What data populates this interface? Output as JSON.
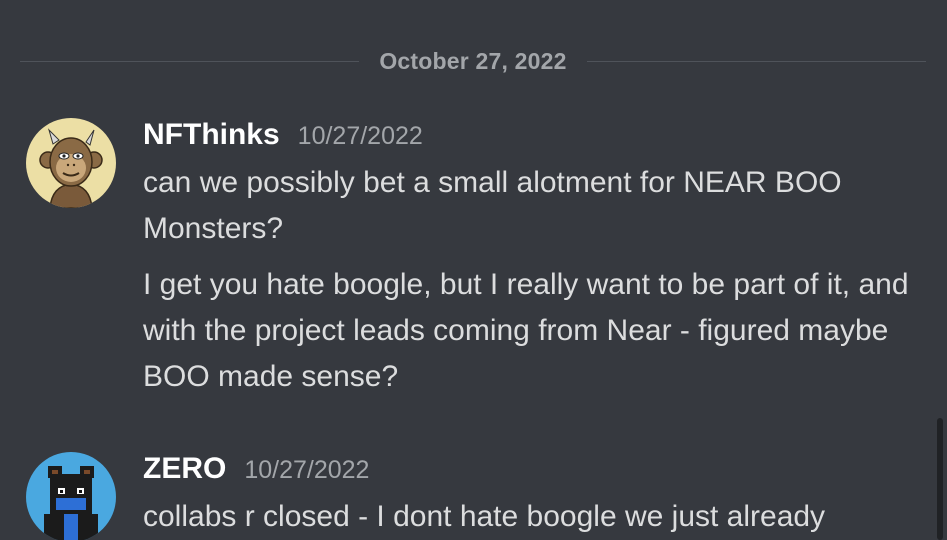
{
  "divider": {
    "date": "October 27, 2022"
  },
  "messages": [
    {
      "username": "NFThinks",
      "timestamp": "10/27/2022",
      "avatar_icon": "bored-ape-avatar-icon",
      "lines": [
        "can we possibly bet a small alotment for NEAR BOO Monsters?",
        "I get you hate boogle, but I really want to be part of it, and with the project leads coming from Near - figured maybe BOO made sense?"
      ]
    },
    {
      "username": "ZERO",
      "timestamp": "10/27/2022",
      "avatar_icon": "masked-bear-avatar-icon",
      "lines": [
        "collabs r closed - I dont hate boogle we  just already"
      ]
    }
  ],
  "colors": {
    "background": "#36393f",
    "username": "#ffffff",
    "message_text": "#dcddde",
    "muted": "#a3a6aa",
    "avatar1_bg": "#ecdfa5",
    "avatar2_bg": "#4aa8e0"
  }
}
